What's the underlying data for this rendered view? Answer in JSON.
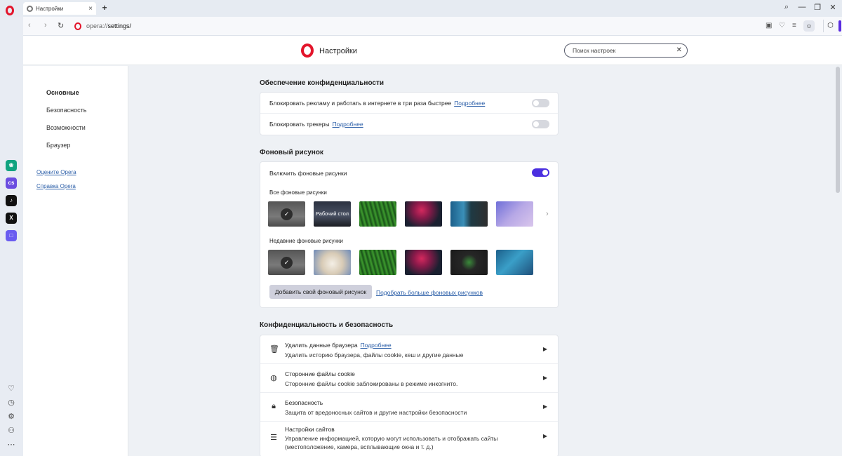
{
  "browser": {
    "tab_title": "Настройки",
    "new_tab": "+",
    "tab_close": "×",
    "url_scheme": "opera://",
    "url_path": "settings/",
    "window_controls": [
      "⌕",
      "—",
      "❐",
      "✕"
    ]
  },
  "header": {
    "title": "Настройки",
    "search_placeholder": "Поиск настроек"
  },
  "nav": {
    "items": [
      "Основные",
      "Безопасность",
      "Возможности",
      "Браузер"
    ],
    "links": [
      "Оцените Opera",
      "Справка Opera"
    ]
  },
  "privacy": {
    "title": "Обеспечение конфиденциальности",
    "rows": [
      {
        "label": "Блокировать рекламу и работать в интернете в три раза быстрее",
        "link": "Подробнее",
        "enabled": false
      },
      {
        "label": "Блокировать трекеры",
        "link": "Подробнее",
        "enabled": false
      }
    ]
  },
  "wallpaper": {
    "title": "Фоновый рисунок",
    "enable_label": "Включить фоновые рисунки",
    "enabled": true,
    "all_label": "Все фоновые рисунки",
    "recent_label": "Недавние фоновые рисунки",
    "desktop_label": "Рабочий стол",
    "add_button": "Добавить свой фоновый рисунок",
    "more_link": "Подобрать больше фоновых рисунков"
  },
  "security": {
    "title": "Конфиденциальность и безопасность",
    "rows": [
      {
        "icon": "trash-icon",
        "title": "Удалить данные браузера",
        "link": "Подробнее",
        "desc": "Удалить историю браузера, файлы cookie, кеш и другие данные"
      },
      {
        "icon": "cookie-icon",
        "title": "Сторонние файлы cookie",
        "link": "",
        "desc": "Сторонние файлы cookie заблокированы в режиме инкогнито."
      },
      {
        "icon": "lock-icon",
        "title": "Безопасность",
        "link": "",
        "desc": "Защита от вредоносных сайтов и другие настройки безопасности"
      },
      {
        "icon": "sliders-icon",
        "title": "Настройки сайтов",
        "link": "",
        "desc": "Управление информацией, которую могут использовать и отображать сайты (местоположение, камера, всплывающие окна и т. д.)"
      }
    ]
  },
  "colors": {
    "accent": "#4b2fe0",
    "opera_red": "#e3152b",
    "link": "#2c5fa8"
  }
}
